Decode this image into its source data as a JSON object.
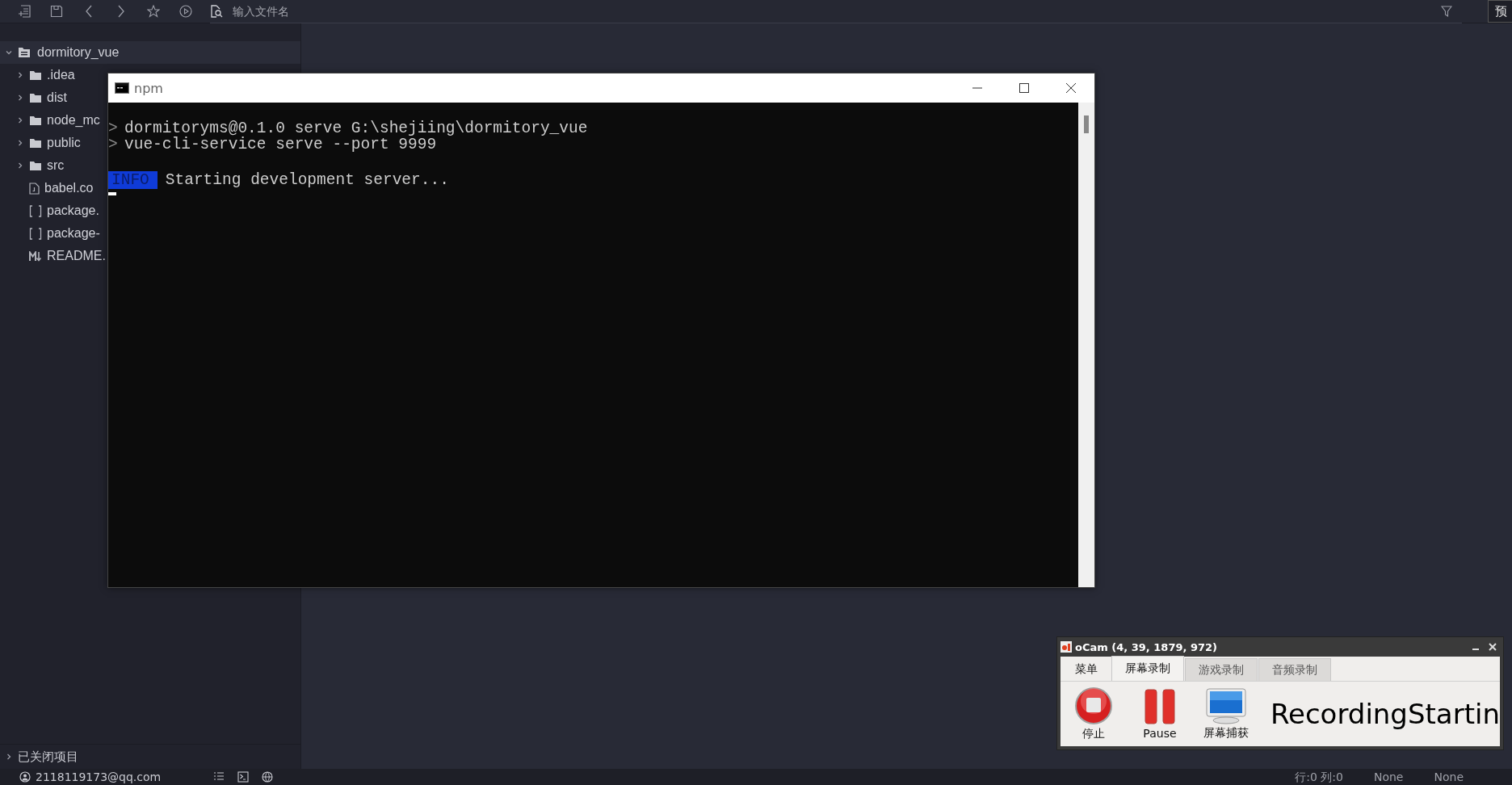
{
  "toolbar": {
    "search": {
      "placeholder": "输入文件名"
    },
    "preview_button": "预"
  },
  "sidebar": {
    "tree": [
      {
        "label": "dormitory_vue",
        "kind": "project",
        "expanded": true,
        "children": [
          {
            "label": ".idea",
            "kind": "folder",
            "expanded": false
          },
          {
            "label": "dist",
            "kind": "folder",
            "expanded": false
          },
          {
            "label": "node_mc",
            "kind": "folder",
            "expanded": false
          },
          {
            "label": "public",
            "kind": "folder",
            "expanded": false
          },
          {
            "label": "src",
            "kind": "folder",
            "expanded": false
          },
          {
            "label": "babel.co",
            "kind": "file"
          },
          {
            "label": "package.",
            "kind": "json"
          },
          {
            "label": "package-",
            "kind": "json"
          },
          {
            "label": "README.",
            "kind": "markdown"
          }
        ]
      }
    ],
    "closed_projects": {
      "label": "已关闭项目",
      "expanded": false
    }
  },
  "terminal_window": {
    "title": "npm",
    "lines": [
      {
        "kind": "prompt",
        "marker": ">",
        "text": "dormitoryms@0.1.0 serve G:\\shejiing\\dormitory_vue"
      },
      {
        "kind": "prompt",
        "marker": ">",
        "text": "vue-cli-service serve --port 9999"
      },
      {
        "kind": "blank"
      },
      {
        "kind": "tagged",
        "tag": "INFO",
        "text": "Starting development server..."
      },
      {
        "kind": "cursor"
      }
    ]
  },
  "ocam": {
    "title": "oCam (4, 39, 1879, 972)",
    "tabs": [
      {
        "label": "菜单",
        "selected": false
      },
      {
        "label": "屏幕录制",
        "selected": true
      },
      {
        "label": "游戏录制",
        "selected": false
      },
      {
        "label": "音频录制",
        "selected": false
      }
    ],
    "buttons": [
      {
        "label": "停止",
        "kind": "stop"
      },
      {
        "label": "Pause",
        "kind": "pause"
      },
      {
        "label": "屏幕捕获",
        "kind": "capture"
      }
    ],
    "status_text": "RecordingStartin"
  },
  "status_bar": {
    "account": "2118119173@qq.com",
    "position": "行:0  列:0",
    "encoding": "None",
    "line_ending": "None"
  }
}
